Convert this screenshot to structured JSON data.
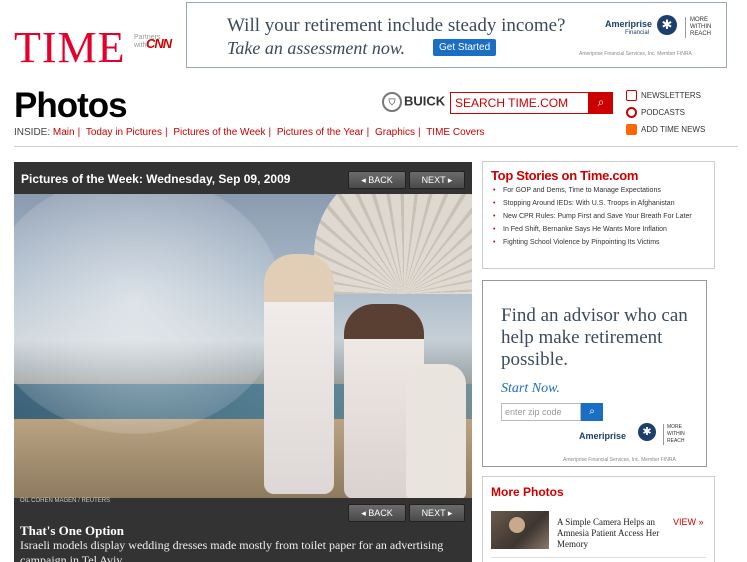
{
  "header": {
    "logo": "TIME",
    "partner_line1": "Partners",
    "partner_line2": "with",
    "partner_brand": "CNN",
    "section_title": "Photos",
    "sponsor": "BUICK",
    "search_placeholder": "SEARCH TIME.COM",
    "links": [
      "NEWSLETTERS",
      "PODCASTS",
      "ADD TIME NEWS"
    ]
  },
  "top_ad": {
    "line1": "Will your retirement include steady income?",
    "line2": "Take an assessment now.",
    "button": "Get Started",
    "brand": "Ameriprise",
    "brand_sub": "Financial",
    "tagline": [
      "MORE",
      "WITHIN",
      "REACH"
    ],
    "fine_print": "Ameriprise Financial Services, Inc. Member FINRA"
  },
  "inside_nav": {
    "label": "INSIDE:",
    "items": [
      "Main",
      "Today in Pictures",
      "Pictures of the Week",
      "Pictures of the Year",
      "Graphics",
      "TIME Covers"
    ]
  },
  "gallery": {
    "title": "Pictures of the Week: Wednesday, Sep 09, 2009",
    "back": "BACK",
    "next": "NEXT",
    "credit": "OIL COHEN MAGEN / REUTERS",
    "caption_title": "That's One Option",
    "caption_text": "Israeli models display wedding dresses made mostly from toilet paper for an advertising campaign in Tel Aviv."
  },
  "top_stories": {
    "title": "Top Stories on Time.com",
    "items": [
      "For GOP and Dems, Time to Manage Expectations",
      "Stopping Around IEDs: With U.S. Troops in Afghanistan",
      "New CPR Rules: Pump First and Save Your Breath For Later",
      "In Fed Shift, Bernanke Says He Wants More Inflation",
      "Fighting School Violence by Pinpointing Its Victims"
    ]
  },
  "side_ad": {
    "headline": "Find an advisor who can help make retirement possible.",
    "cta": "Start Now.",
    "zip_placeholder": "enter zip code",
    "brand": "Ameriprise",
    "brand_sub": "Financial",
    "tagline": [
      "MORE",
      "WITHIN",
      "REACH"
    ],
    "fine_print": "Ameriprise Financial Services, Inc. Member FINRA"
  },
  "more_photos": {
    "title": "More Photos",
    "item_text": "A Simple Camera Helps an Amnesia Patient Access Her Memory",
    "view": "VIEW »"
  }
}
